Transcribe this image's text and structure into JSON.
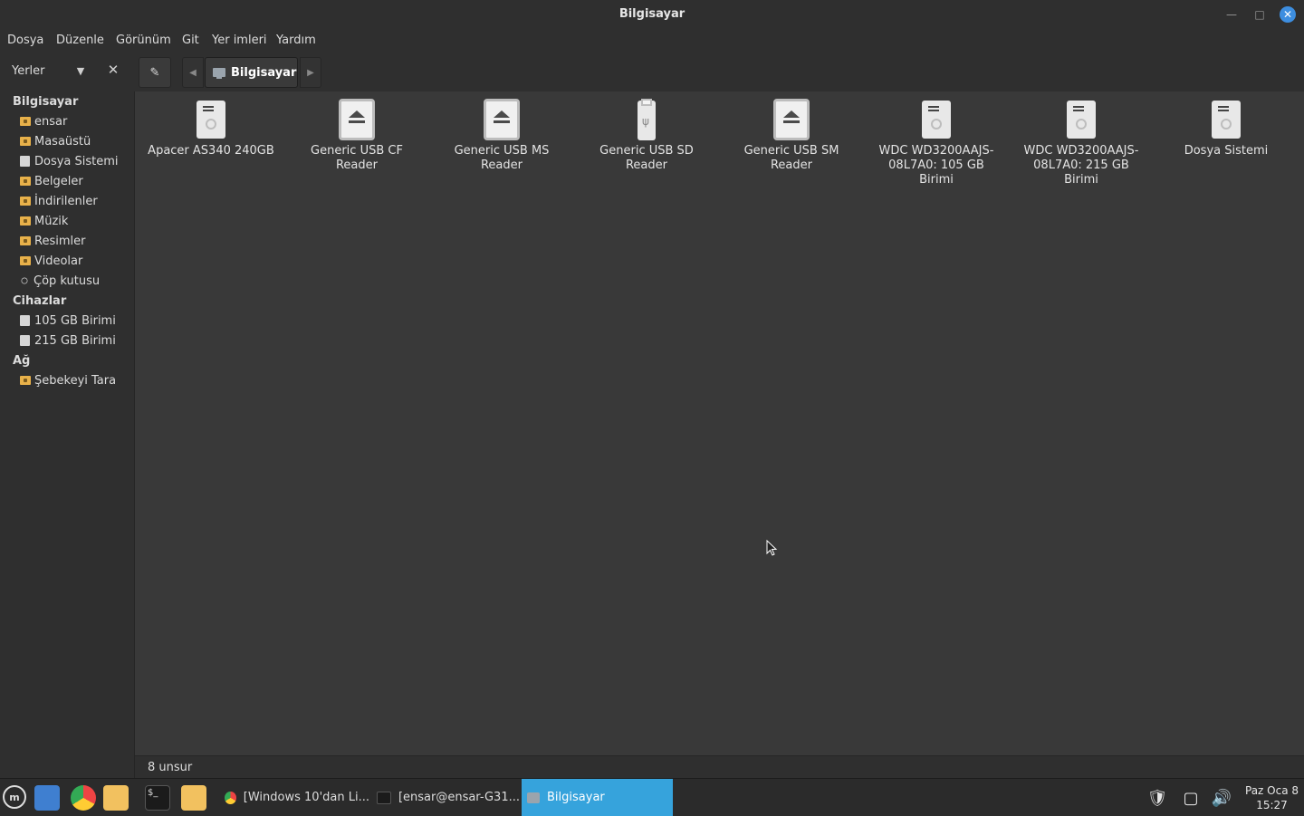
{
  "window": {
    "title": "Bilgisayar"
  },
  "menu": [
    "Dosya",
    "Düzenle",
    "Görünüm",
    "Git",
    "Yer imleri",
    "Yardım"
  ],
  "toolbar": {
    "places_label": "Yerler",
    "breadcrumb": "Bilgisayar"
  },
  "sidebar": {
    "sections": [
      {
        "title": "Bilgisayar",
        "items": [
          "ensar",
          "Masaüstü",
          "Dosya Sistemi",
          "Belgeler",
          "İndirilenler",
          "Müzik",
          "Resimler",
          "Videolar",
          "Çöp kutusu"
        ]
      },
      {
        "title": "Cihazlar",
        "items": [
          "105 GB Birimi",
          "215 GB Birimi"
        ]
      },
      {
        "title": "Ağ",
        "items": [
          "Şebekeyi Tara"
        ]
      }
    ]
  },
  "devices": [
    {
      "label": "Apacer AS340 240GB",
      "icon": "hard-drive-icon"
    },
    {
      "label": "Generic USB CF Reader",
      "icon": "eject-drive-icon"
    },
    {
      "label": "Generic USB MS Reader",
      "icon": "eject-drive-icon"
    },
    {
      "label": "Generic USB SD Reader",
      "icon": "usb-drive-icon"
    },
    {
      "label": "Generic USB SM Reader",
      "icon": "eject-drive-icon"
    },
    {
      "label": "WDC WD3200AAJS-08L7A0: 105 GB Birimi",
      "icon": "hard-drive-icon"
    },
    {
      "label": "WDC WD3200AAJS-08L7A0: 215 GB Birimi",
      "icon": "hard-drive-icon"
    },
    {
      "label": "Dosya Sistemi",
      "icon": "hard-drive-icon"
    }
  ],
  "status": {
    "item_count": "8 unsur"
  },
  "taskbar": {
    "tasks": [
      "[Windows 10'dan Li...",
      "[ensar@ensar-G31...",
      "Bilgisayar"
    ],
    "clock_date": "Paz Oca 8",
    "clock_time": "15:27"
  },
  "colors": {
    "accent": "#36a3dc",
    "folder": "#e8b14a",
    "close_button": "#3d8ee0"
  }
}
